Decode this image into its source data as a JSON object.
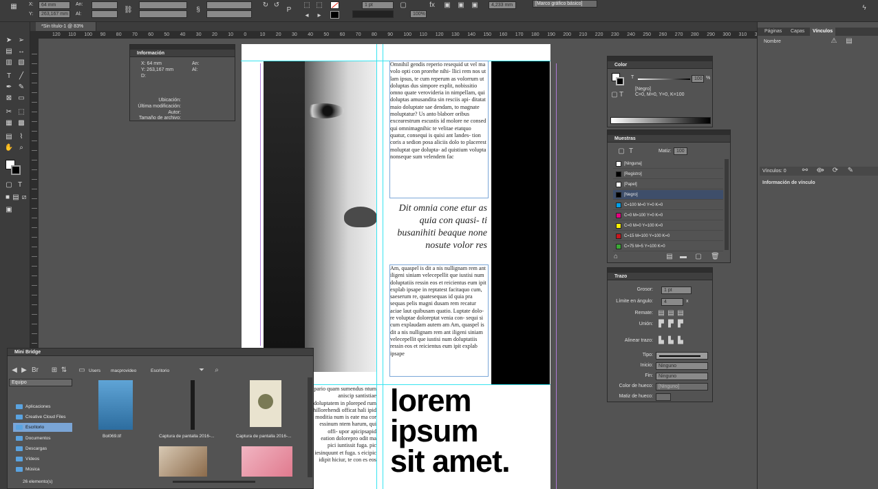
{
  "control_bar": {
    "x_value": "64 mm",
    "y_value": "263,167 mm",
    "w_label": "An:",
    "h_label": "Al:",
    "x_label": "X:",
    "y_label": "Y:",
    "stroke_weight": "1 pt",
    "zoom": "100%",
    "offset": "4,233 mm",
    "frame_style": "[Marco gráfico básico]"
  },
  "document_tab": "*Sin título-1 @ 83%",
  "ruler_ticks": [
    "120",
    "110",
    "100",
    "90",
    "80",
    "70",
    "60",
    "50",
    "40",
    "30",
    "20",
    "10",
    "0",
    "10",
    "20",
    "30",
    "40",
    "50",
    "60",
    "70",
    "80",
    "90",
    "100",
    "110",
    "120",
    "130",
    "140",
    "150",
    "160",
    "170",
    "180",
    "190",
    "200",
    "210",
    "220",
    "230",
    "240",
    "250",
    "260",
    "270",
    "280",
    "290",
    "300",
    "310",
    "320"
  ],
  "info_panel": {
    "title": "Información",
    "x": "X: 64 mm",
    "y": "Y: 263,167 mm",
    "d": "D:",
    "w": "An:",
    "h": "Al:",
    "location": "Ubicación:",
    "modified": "Última modificación:",
    "author": "Autor:",
    "filesize": "Tamaño de archivo:"
  },
  "page": {
    "body_top": "Omnihil gendis reperio resequid ut vel ma volo opti con prorehe nihi- llici rem nos ut lam ipsus, te cum reperum as volorrum ut doluptas dus simpore explit, nobissitio omno quate verovideria in nimpellam, qui doluptas amusandita sin resciis api- ditatat maio doluptate sae dendam, to magnate moluptatur? Us anto blaborr oribus excearestrum escustis id molore ne consed qui omnimagnihic te velitae etatquo quatur, consequi is quisi ant landes- tion coris a sedion posa aliciis dolo to placerest moluptat que dolupta- ad quistium volupta nonseque sum velendem fac",
    "quote": "Dit omnia cone etur as quia con quasi- ti busanihiti beaque none nosute volor res",
    "body_bottom": "Am, quaspel is dit a nis nullignam rem ant iligeni siniam velecepellit que iustisi num doluptatiis ressin eos et reicientus eum ipit explab ipsape in reptatest facitaquo cum, saeserum re, quatesequas id quia pra sequas pelis magni dusam rem recatur aciae laut quibusam quatio. Luptate dolo- re voluptae doloreptat venia con- sequi si cum explaudam autem am Am, quaspel is dit a nis nullignam rem ant iligeni siniam velecepellit que iustisi num doluptatiis ressin eos et reicientus eum ipit explab ipsape",
    "body_left": "pario quam sumendus ntum aniscip santistiae doluptatem in ploreped rum hillorehendi officat hali ipid moditia num is eate ma cor essinum ntem harum, qui offi- upor apicipsapid eation dolorepro odit ma pici iuntissit fuga. pic iesinquunt et fuga. s eicipic idipit hiciur, te con es eos",
    "big_text": [
      "lorem",
      "ipsum",
      "sit amet."
    ]
  },
  "color_panel": {
    "title": "Color",
    "tint": "100",
    "unit": "%",
    "name": "[Negro]",
    "cmyk": "C=0, M=0, Y=0, K=100"
  },
  "swatches_panel": {
    "title": "Muestras",
    "tint_label": "Matiz:",
    "tint": "100",
    "items": [
      {
        "name": "[Ninguna]",
        "color": "#ffffff"
      },
      {
        "name": "[Registro]",
        "color": "#000000"
      },
      {
        "name": "[Papel]",
        "color": "#ffffff"
      },
      {
        "name": "[Negro]",
        "color": "#000000"
      },
      {
        "name": "C=100 M=0 Y=0 K=0",
        "color": "#00a0e9"
      },
      {
        "name": "C=0 M=100 Y=0 K=0",
        "color": "#e4007f"
      },
      {
        "name": "C=0 M=0 Y=100 K=0",
        "color": "#fff100"
      },
      {
        "name": "C=15 M=100 Y=100 K=0",
        "color": "#c9161d"
      },
      {
        "name": "C=75 M=5 Y=100 K=0",
        "color": "#3ba935"
      }
    ]
  },
  "stroke_panel": {
    "title": "Trazo",
    "weight_label": "Grosor:",
    "weight": "1 pt",
    "miter_label": "Límite en ángulo:",
    "miter": "4",
    "miter_suffix": "x",
    "cap_label": "Remate:",
    "join_label": "Unión:",
    "align_label": "Alinear trazo:",
    "type_label": "Tipo:",
    "start_label": "Inicio:",
    "start": "Ninguno",
    "end_label": "Fin:",
    "end": "Ninguno",
    "gap_color_label": "Color de hueco:",
    "gap_color": "[Ninguno]",
    "gap_tint_label": "Matiz de hueco:"
  },
  "right_dock": {
    "tabs": [
      "Páginas",
      "Capas",
      "Vínculos"
    ],
    "column": "Nombre",
    "links_count": "Vínculos: 0",
    "link_info": "Información de vínculo"
  },
  "mini_bridge": {
    "title": "Mini Bridge",
    "path": [
      "Users",
      "macprovideo",
      "Escritorio"
    ],
    "dropdown": "Equipo",
    "folders": [
      "Aplicaciones",
      "Creative Cloud Files",
      "Escritorio",
      "Documentos",
      "Descargas",
      "Vídeos",
      "Música"
    ],
    "files": [
      "Bol069.tif",
      "Captura de pantalla 2016-...",
      "Captura de pantalla 2016-..."
    ],
    "status": "26 elemento(s)"
  }
}
